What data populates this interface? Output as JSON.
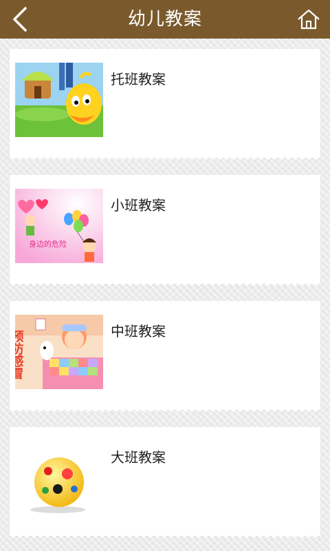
{
  "header": {
    "title": "幼儿教案"
  },
  "lessons": [
    {
      "label": "托班教案",
      "thumb_icon": "duck-cartoon-icon"
    },
    {
      "label": "小班教案",
      "thumb_icon": "balloons-children-cartoon-icon",
      "thumb_text": "身边的危险"
    },
    {
      "label": "中班教案",
      "thumb_icon": "sick-child-cartoon-icon",
      "thumb_text": "预防感冒"
    },
    {
      "label": "大班教案",
      "thumb_icon": "ball-cartoon-icon"
    }
  ]
}
